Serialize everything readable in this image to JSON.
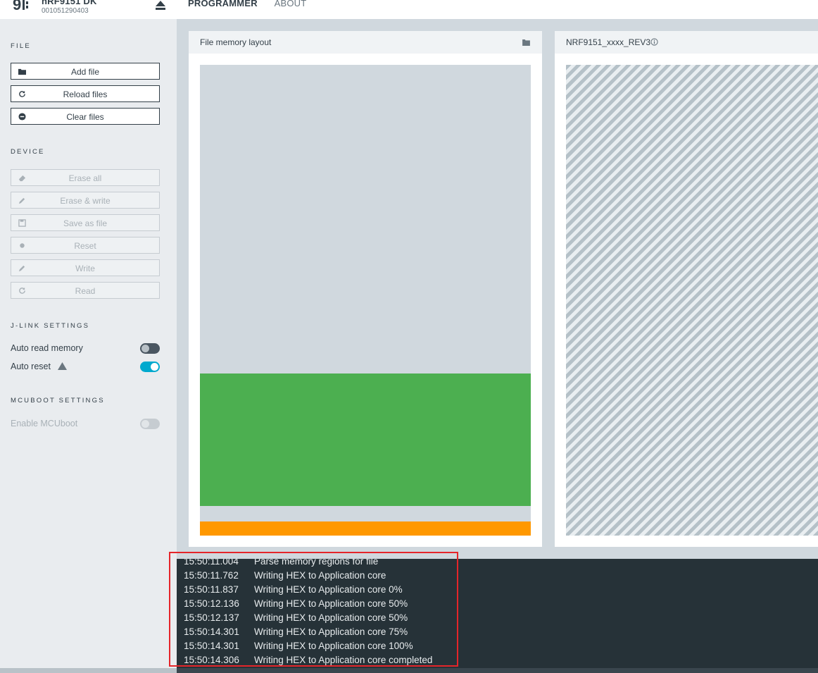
{
  "header": {
    "device_name": "nRF9151 DK",
    "device_serial": "001051290403",
    "nav": [
      {
        "label": "PROGRAMMER",
        "active": true
      },
      {
        "label": "ABOUT",
        "active": false
      }
    ]
  },
  "sidebar": {
    "file_section": {
      "title": "FILE",
      "buttons": [
        {
          "label": "Add file",
          "icon": "folder-icon"
        },
        {
          "label": "Reload files",
          "icon": "reload-icon"
        },
        {
          "label": "Clear files",
          "icon": "minus-circle-icon"
        }
      ]
    },
    "device_section": {
      "title": "DEVICE",
      "buttons": [
        {
          "label": "Erase all",
          "icon": "eraser-icon",
          "enabled": false
        },
        {
          "label": "Erase & write",
          "icon": "pencil-icon",
          "enabled": false
        },
        {
          "label": "Save as file",
          "icon": "save-icon",
          "enabled": false
        },
        {
          "label": "Reset",
          "icon": "dot-icon",
          "enabled": false
        },
        {
          "label": "Write",
          "icon": "pencil-icon",
          "enabled": false
        },
        {
          "label": "Read",
          "icon": "reload-icon",
          "enabled": false
        }
      ]
    },
    "jlink_section": {
      "title": "J-LINK SETTINGS",
      "auto_read_memory": {
        "label": "Auto read memory",
        "on": false
      },
      "auto_reset": {
        "label": "Auto reset",
        "on": true,
        "icon": "warning-icon"
      }
    },
    "mcuboot_section": {
      "title": "MCUBOOT SETTINGS",
      "enable_mcuboot": {
        "label": "Enable MCUboot",
        "on": false,
        "enabled": false
      }
    }
  },
  "panels": {
    "file_memory": {
      "title": "File memory layout",
      "icon": "folder-icon",
      "regions_color": {
        "empty": "#d0d8de",
        "application": "#4caf50",
        "other": "#ff9800"
      }
    },
    "device_memory": {
      "title": "NRF9151_xxxx_REV3",
      "icon": "info-icon",
      "fill": "striped"
    }
  },
  "log": {
    "entries": [
      {
        "time": "15:50:11.004",
        "message": "Parse memory regions for file"
      },
      {
        "time": "15:50:11.762",
        "message": "Writing HEX to Application core"
      },
      {
        "time": "15:50:11.837",
        "message": "Writing HEX to Application core 0%"
      },
      {
        "time": "15:50:12.136",
        "message": "Writing HEX to Application core 50%"
      },
      {
        "time": "15:50:12.137",
        "message": "Writing HEX to Application core 50%"
      },
      {
        "time": "15:50:14.301",
        "message": "Writing HEX to Application core 75%"
      },
      {
        "time": "15:50:14.301",
        "message": "Writing HEX to Application core 100%"
      },
      {
        "time": "15:50:14.306",
        "message": "Writing HEX to Application core completed"
      }
    ]
  }
}
